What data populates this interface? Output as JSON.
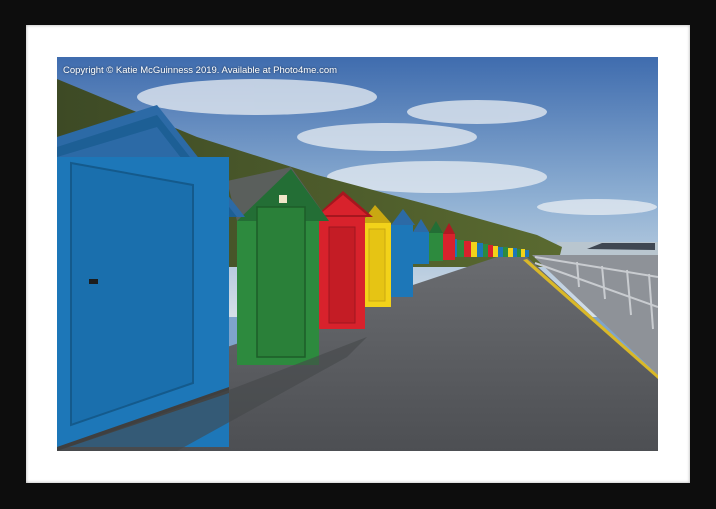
{
  "watermark": {
    "text": "Copyright  © Katie McGuinness  2019. Available at Photo4me.com"
  },
  "scene": {
    "description_colors": {
      "sky_top": "#4f78b5",
      "sky_bottom": "#c9d8e6",
      "hill": "#4a5a2a",
      "path": "#5d5f63",
      "hut_blue": "#1d77b8",
      "hut_green": "#2d8a3e",
      "hut_red": "#d8222c",
      "hut_yellow": "#f2d21a",
      "frame": "#0d0d0d",
      "mount": "#ffffff"
    }
  }
}
